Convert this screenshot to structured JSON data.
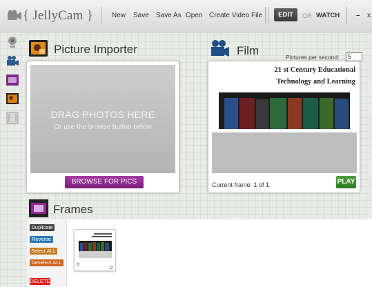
{
  "app": {
    "title": "{ JellyCam }"
  },
  "toolbar": {
    "new_label": "New",
    "save_label": "Save",
    "save_as_label": "Save As",
    "open_label": "Open",
    "create_video_label": "Create Video File",
    "edit_label": "EDIT",
    "or_label": "OR",
    "watch_label": "WATCH",
    "minimize_label": "–",
    "close_label": "x"
  },
  "left_toolbar": {
    "icons": [
      "webcam-icon",
      "movie-camera-icon",
      "frames-icon",
      "picture-importer-icon",
      "film-strip-icon"
    ]
  },
  "importer": {
    "title": "Picture Importer",
    "drop_title": "DRAG PHOTOS HERE",
    "drop_sub": "Or use the browse button below",
    "browse_label": "BROWSE FOR PICS"
  },
  "film": {
    "title": "Film",
    "pps_label": "Pictures per second:",
    "pps_value": "5",
    "doc_line1": "21 st Century Educational",
    "doc_line2": "Technology and Learning",
    "current_frame_label": "Current frame: 1 of 1",
    "play_label": "PLAY"
  },
  "frames": {
    "title": "Frames",
    "buttons": {
      "duplicate": "Duplicate",
      "reverse": "Reverse",
      "select_all": "Select ALL",
      "deselect_all": "Deselect ALL",
      "delete": "DELETE"
    },
    "thumb": {
      "left_num": "0",
      "right_num": "0"
    }
  },
  "colors": {
    "accent_purple": "#8e2a8e",
    "play_green": "#3c8c2e",
    "reverse_blue": "#2a7bb8",
    "select_orange": "#c97a1e",
    "deselect_orange": "#d0641c",
    "delete_red": "#e01818"
  }
}
